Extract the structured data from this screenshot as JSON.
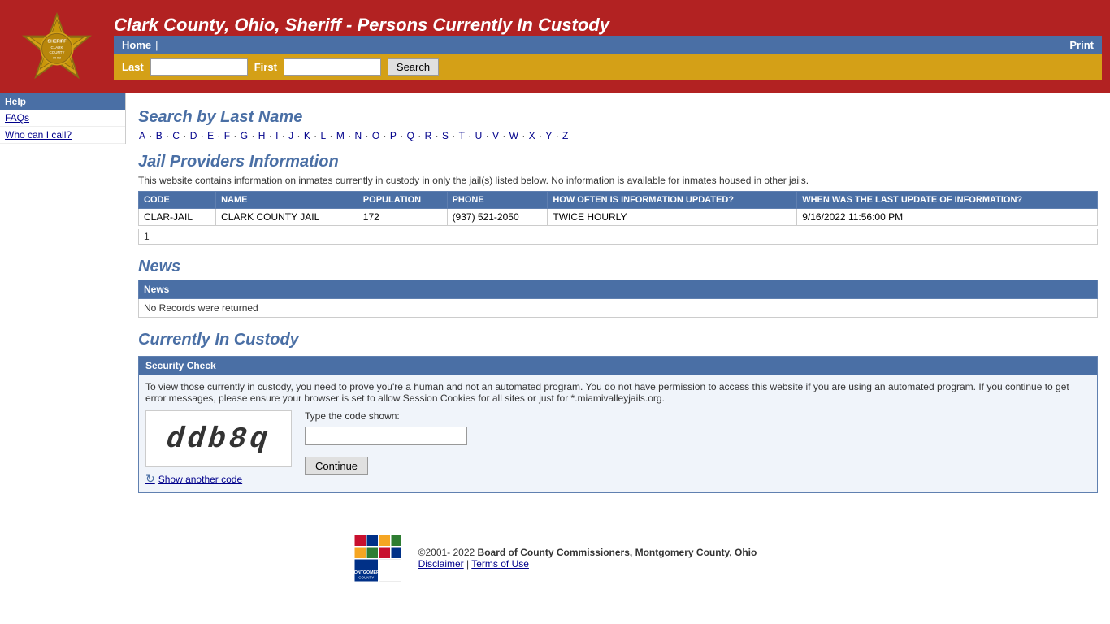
{
  "header": {
    "title": "Clark County, Ohio, Sheriff - Persons Currently In Custody",
    "nav": {
      "home": "Home",
      "print": "Print"
    }
  },
  "search": {
    "last_label": "Last",
    "first_label": "First",
    "button": "Search"
  },
  "sidebar": {
    "help_header": "Help",
    "items": [
      {
        "label": "FAQs",
        "id": "faqs"
      },
      {
        "label": "Who can I call?",
        "id": "who-can-i-call"
      }
    ]
  },
  "search_section": {
    "heading": "Search by Last Name",
    "alphabet": [
      "A",
      "B",
      "C",
      "D",
      "E",
      "F",
      "G",
      "H",
      "I",
      "J",
      "K",
      "L",
      "M",
      "N",
      "O",
      "P",
      "Q",
      "R",
      "S",
      "T",
      "U",
      "V",
      "W",
      "X",
      "Y",
      "Z"
    ]
  },
  "jail_providers": {
    "heading": "Jail Providers Information",
    "info_text": "This website contains information on inmates currently in custody in only the jail(s) listed below. No information is available for inmates housed in other jails.",
    "columns": [
      "CODE",
      "NAME",
      "POPULATION",
      "PHONE",
      "HOW OFTEN IS INFORMATION UPDATED?",
      "WHEN WAS THE LAST UPDATE OF INFORMATION?"
    ],
    "rows": [
      {
        "code": "CLAR-JAIL",
        "name": "CLARK COUNTY JAIL",
        "population": "172",
        "phone": "(937) 521-2050",
        "update_freq": "TWICE HOURLY",
        "last_update": "9/16/2022 11:56:00 PM"
      }
    ],
    "footer_count": "1"
  },
  "news": {
    "heading": "News",
    "table_header": "News",
    "no_records": "No Records were returned"
  },
  "custody": {
    "heading": "Currently In Custody",
    "security_header": "Security Check",
    "security_text": "To view those currently in custody, you need to prove you're a human and not an automated program. You do not have permission to access this website if you are using an automated program. If you continue to get error messages, please ensure your browser is set to allow Session Cookies for all sites or just for *.miamivalleyjails.org.",
    "captcha_label": "Type the code shown:",
    "captcha_value": "ddb8q",
    "show_another": "Show another code",
    "continue_btn": "Continue"
  },
  "footer": {
    "copyright": "©2001- 2022",
    "org": "Board of County Commissioners, Montgomery County, Ohio",
    "disclaimer": "Disclaimer",
    "separator": "|",
    "terms": "Terms of Use"
  }
}
